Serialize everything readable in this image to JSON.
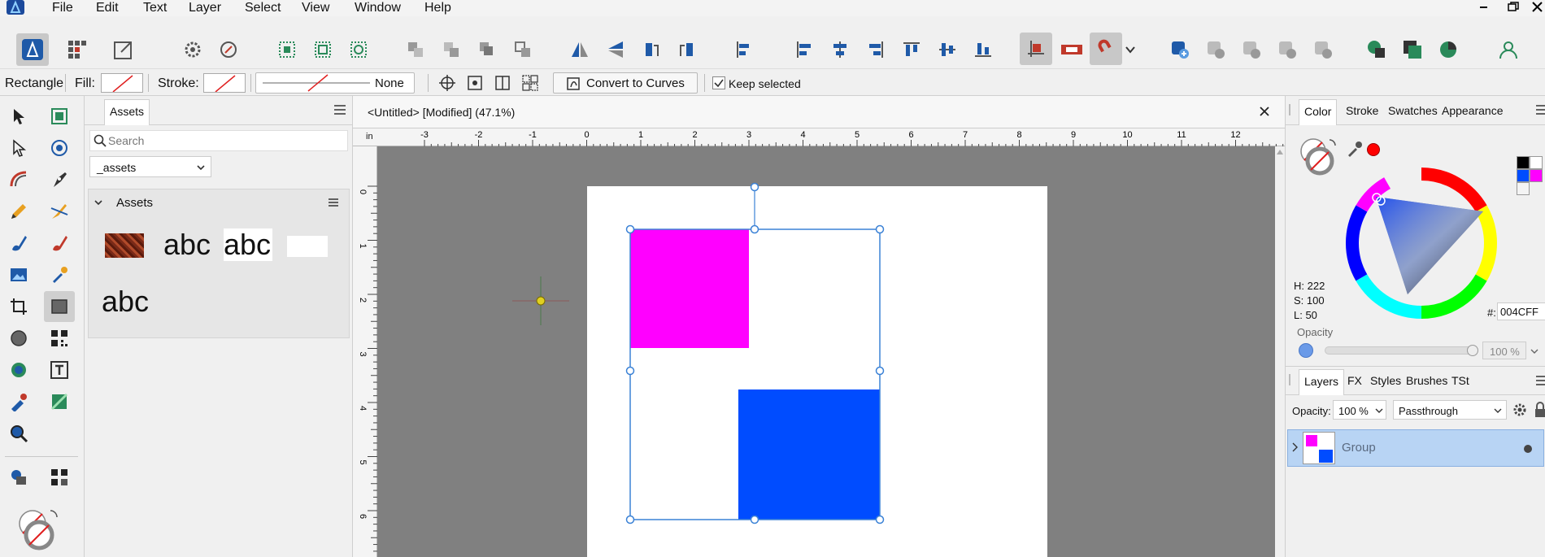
{
  "menu": {
    "items": [
      "File",
      "Edit",
      "Text",
      "Layer",
      "Select",
      "View",
      "Window",
      "Help"
    ]
  },
  "context": {
    "tool_name": "Rectangle",
    "fill_label": "Fill:",
    "stroke_label": "Stroke:",
    "stroke_style": "None",
    "convert_label": "Convert to Curves",
    "keep_selected_label": "Keep selected"
  },
  "assets": {
    "tab_label": "Assets",
    "search_placeholder": "Search",
    "dropdown_value": "_assets",
    "section_title": "Assets",
    "items": [
      "abc",
      "abc",
      "abc"
    ]
  },
  "document": {
    "title": "<Untitled> [Modified] (47.1%)",
    "units": "in",
    "h_ticks": [
      "-3",
      "-2",
      "-1",
      "0",
      "1",
      "2",
      "3",
      "4",
      "5",
      "6",
      "7",
      "8",
      "9",
      "10",
      "11",
      "12"
    ],
    "v_ticks": [
      "0",
      "1",
      "2",
      "3",
      "4",
      "5",
      "6"
    ]
  },
  "color_panel": {
    "tabs": [
      "Color",
      "Stroke",
      "Swatches",
      "Appearance"
    ],
    "hue": "H: 222",
    "sat": "S: 100",
    "lig": "L: 50",
    "hex_label": "#:",
    "hex_value": "004CFF",
    "opacity_label": "Opacity",
    "opacity_value": "100 %"
  },
  "layers_panel": {
    "tabs": [
      "Layers",
      "FX",
      "Styles",
      "Brushes",
      "TSt"
    ],
    "opacity_label": "Opacity:",
    "opacity_value": "100 %",
    "blend_mode": "Passthrough",
    "layer_name": "Group"
  },
  "colors": {
    "magenta": "#ff00ff",
    "blue": "#004cff",
    "selection": "#3b82d6"
  }
}
